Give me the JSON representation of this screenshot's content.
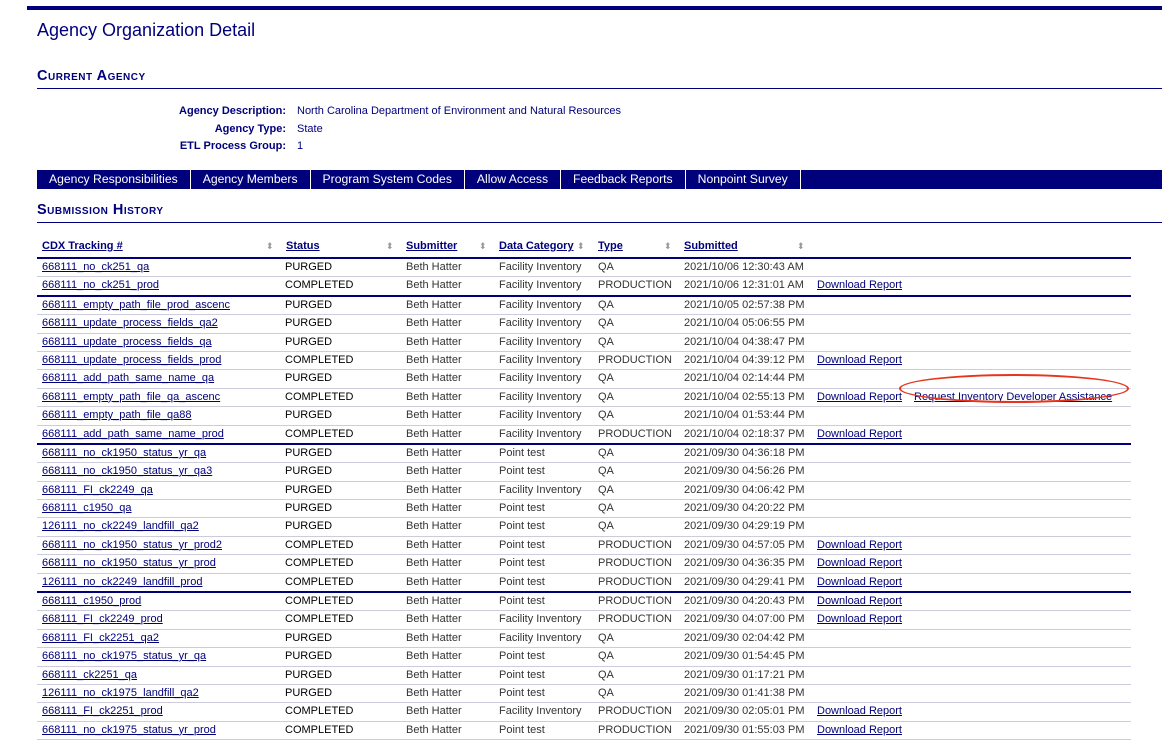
{
  "page_title": "Agency Organization Detail",
  "current_agency": {
    "heading": "Current Agency",
    "fields": [
      {
        "label": "Agency Description:",
        "value": "North Carolina Department of Environment and Natural Resources"
      },
      {
        "label": "Agency Type:",
        "value": "State"
      },
      {
        "label": "ETL Process Group:",
        "value": "1"
      }
    ]
  },
  "nav": [
    "Agency Responsibilities",
    "Agency Members",
    "Program System Codes",
    "Allow Access",
    "Feedback Reports",
    "Nonpoint Survey"
  ],
  "history": {
    "heading": "Submission History",
    "columns": [
      "CDX Tracking #",
      "Status",
      "Submitter",
      "Data Category",
      "Type",
      "Submitted"
    ],
    "rows": [
      {
        "track": "668111_no_ck251_qa",
        "status": "PURGED",
        "submitter": "Beth Hatter",
        "category": "Facility Inventory",
        "type": "QA",
        "submitted": "2021/10/06 12:30:43 AM",
        "download": "",
        "request": ""
      },
      {
        "track": "668111_no_ck251_prod",
        "status": "COMPLETED",
        "submitter": "Beth Hatter",
        "category": "Facility Inventory",
        "type": "PRODUCTION",
        "submitted": "2021/10/06 12:31:01 AM",
        "download": "Download Report",
        "request": ""
      },
      {
        "track": "668111_empty_path_file_prod_ascenc",
        "status": "PURGED",
        "submitter": "Beth Hatter",
        "category": "Facility Inventory",
        "type": "QA",
        "submitted": "2021/10/05 02:57:38 PM",
        "download": "",
        "request": ""
      },
      {
        "track": "668111_update_process_fields_qa2",
        "status": "PURGED",
        "submitter": "Beth Hatter",
        "category": "Facility Inventory",
        "type": "QA",
        "submitted": "2021/10/04 05:06:55 PM",
        "download": "",
        "request": ""
      },
      {
        "track": "668111_update_process_fields_qa",
        "status": "PURGED",
        "submitter": "Beth Hatter",
        "category": "Facility Inventory",
        "type": "QA",
        "submitted": "2021/10/04 04:38:47 PM",
        "download": "",
        "request": ""
      },
      {
        "track": "668111_update_process_fields_prod",
        "status": "COMPLETED",
        "submitter": "Beth Hatter",
        "category": "Facility Inventory",
        "type": "PRODUCTION",
        "submitted": "2021/10/04 04:39:12 PM",
        "download": "Download Report",
        "request": ""
      },
      {
        "track": "668111_add_path_same_name_qa",
        "status": "PURGED",
        "submitter": "Beth Hatter",
        "category": "Facility Inventory",
        "type": "QA",
        "submitted": "2021/10/04 02:14:44 PM",
        "download": "",
        "request": ""
      },
      {
        "track": "668111_empty_path_file_qa_ascenc",
        "status": "COMPLETED",
        "submitter": "Beth Hatter",
        "category": "Facility Inventory",
        "type": "QA",
        "submitted": "2021/10/04 02:55:13 PM",
        "download": "Download Report",
        "request": "Request Inventory Developer Assistance"
      },
      {
        "track": "668111_empty_path_file_qa88",
        "status": "PURGED",
        "submitter": "Beth Hatter",
        "category": "Facility Inventory",
        "type": "QA",
        "submitted": "2021/10/04 01:53:44 PM",
        "download": "",
        "request": ""
      },
      {
        "track": "668111_add_path_same_name_prod",
        "status": "COMPLETED",
        "submitter": "Beth Hatter",
        "category": "Facility Inventory",
        "type": "PRODUCTION",
        "submitted": "2021/10/04 02:18:37 PM",
        "download": "Download Report",
        "request": ""
      },
      {
        "track": "668111_no_ck1950_status_yr_qa",
        "status": "PURGED",
        "submitter": "Beth Hatter",
        "category": "Point test",
        "type": "QA",
        "submitted": "2021/09/30 04:36:18 PM",
        "download": "",
        "request": ""
      },
      {
        "track": "668111_no_ck1950_status_yr_qa3",
        "status": "PURGED",
        "submitter": "Beth Hatter",
        "category": "Point test",
        "type": "QA",
        "submitted": "2021/09/30 04:56:26 PM",
        "download": "",
        "request": ""
      },
      {
        "track": "668111_FI_ck2249_qa",
        "status": "PURGED",
        "submitter": "Beth Hatter",
        "category": "Facility Inventory",
        "type": "QA",
        "submitted": "2021/09/30 04:06:42 PM",
        "download": "",
        "request": ""
      },
      {
        "track": "668111_c1950_qa",
        "status": "PURGED",
        "submitter": "Beth Hatter",
        "category": "Point test",
        "type": "QA",
        "submitted": "2021/09/30 04:20:22 PM",
        "download": "",
        "request": ""
      },
      {
        "track": "126111_no_ck2249_landfill_qa2",
        "status": "PURGED",
        "submitter": "Beth Hatter",
        "category": "Point test",
        "type": "QA",
        "submitted": "2021/09/30 04:29:19 PM",
        "download": "",
        "request": ""
      },
      {
        "track": "668111_no_ck1950_status_yr_prod2",
        "status": "COMPLETED",
        "submitter": "Beth Hatter",
        "category": "Point test",
        "type": "PRODUCTION",
        "submitted": "2021/09/30 04:57:05 PM",
        "download": "Download Report",
        "request": ""
      },
      {
        "track": "668111_no_ck1950_status_yr_prod",
        "status": "COMPLETED",
        "submitter": "Beth Hatter",
        "category": "Point test",
        "type": "PRODUCTION",
        "submitted": "2021/09/30 04:36:35 PM",
        "download": "Download Report",
        "request": ""
      },
      {
        "track": "126111_no_ck2249_landfill_prod",
        "status": "COMPLETED",
        "submitter": "Beth Hatter",
        "category": "Point test",
        "type": "PRODUCTION",
        "submitted": "2021/09/30 04:29:41 PM",
        "download": "Download Report",
        "request": ""
      },
      {
        "track": "668111_c1950_prod",
        "status": "COMPLETED",
        "submitter": "Beth Hatter",
        "category": "Point test",
        "type": "PRODUCTION",
        "submitted": "2021/09/30 04:20:43 PM",
        "download": "Download Report",
        "request": ""
      },
      {
        "track": "668111_FI_ck2249_prod",
        "status": "COMPLETED",
        "submitter": "Beth Hatter",
        "category": "Facility Inventory",
        "type": "PRODUCTION",
        "submitted": "2021/09/30 04:07:00 PM",
        "download": "Download Report",
        "request": ""
      },
      {
        "track": "668111_FI_ck2251_qa2",
        "status": "PURGED",
        "submitter": "Beth Hatter",
        "category": "Facility Inventory",
        "type": "QA",
        "submitted": "2021/09/30 02:04:42 PM",
        "download": "",
        "request": ""
      },
      {
        "track": "668111_no_ck1975_status_yr_qa",
        "status": "PURGED",
        "submitter": "Beth Hatter",
        "category": "Point test",
        "type": "QA",
        "submitted": "2021/09/30 01:54:45 PM",
        "download": "",
        "request": ""
      },
      {
        "track": "668111_ck2251_qa",
        "status": "PURGED",
        "submitter": "Beth Hatter",
        "category": "Point test",
        "type": "QA",
        "submitted": "2021/09/30 01:17:21 PM",
        "download": "",
        "request": ""
      },
      {
        "track": "126111_no_ck1975_landfill_qa2",
        "status": "PURGED",
        "submitter": "Beth Hatter",
        "category": "Point test",
        "type": "QA",
        "submitted": "2021/09/30 01:41:38 PM",
        "download": "",
        "request": ""
      },
      {
        "track": "668111_FI_ck2251_prod",
        "status": "COMPLETED",
        "submitter": "Beth Hatter",
        "category": "Facility Inventory",
        "type": "PRODUCTION",
        "submitted": "2021/09/30 02:05:01 PM",
        "download": "Download Report",
        "request": ""
      },
      {
        "track": "668111_no_ck1975_status_yr_prod",
        "status": "COMPLETED",
        "submitter": "Beth Hatter",
        "category": "Point test",
        "type": "PRODUCTION",
        "submitted": "2021/09/30 01:55:03 PM",
        "download": "Download Report",
        "request": ""
      }
    ]
  }
}
